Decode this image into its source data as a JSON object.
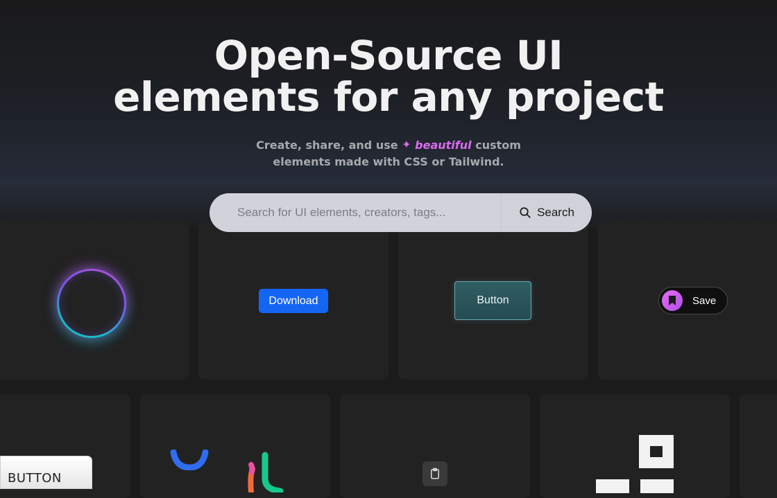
{
  "hero": {
    "title_line1": "Open-Source UI",
    "title_line2": "elements for any project",
    "subtitle_part1": "Create, share, and use",
    "subtitle_highlight": "beautiful",
    "subtitle_part2": "custom",
    "subtitle_line2": "elements made with CSS or Tailwind."
  },
  "search": {
    "placeholder": "Search for UI elements, creators, tags...",
    "button_label": "Search"
  },
  "cards": {
    "download_label": "Download",
    "glass_button_label": "Button",
    "save_label": "Save"
  },
  "corner_button_label": "BUTTON",
  "colors": {
    "accent_purple": "#d96cf0",
    "download_blue": "#1565f5",
    "background": "#1b1b1c",
    "card": "#222222"
  },
  "icons": {
    "sparkle": "sparkle-icon",
    "search": "search-icon",
    "bookmark": "bookmark-icon",
    "clipboard": "clipboard-icon"
  }
}
